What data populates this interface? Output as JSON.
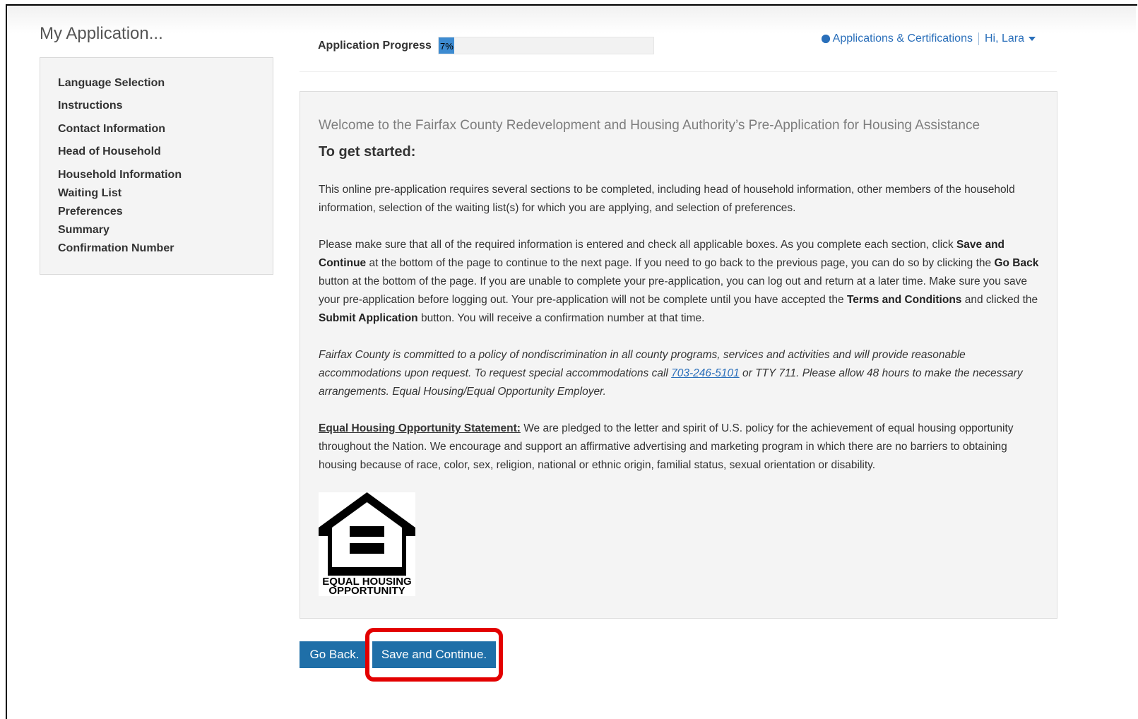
{
  "app_title": "My Application...",
  "sidebar": {
    "items": [
      {
        "label": "Language Selection"
      },
      {
        "label": "Instructions"
      },
      {
        "label": "Contact Information"
      },
      {
        "label": "Head of Household"
      },
      {
        "label": "Household Information"
      },
      {
        "label": "Waiting List"
      },
      {
        "label": "Preferences"
      },
      {
        "label": "Summary"
      },
      {
        "label": "Confirmation Number"
      }
    ]
  },
  "progress": {
    "label": "Application Progress",
    "percent_text": "7%",
    "value": 0.07
  },
  "header": {
    "applications_link": "Applications & Certifications",
    "user_menu": "Hi, Lara",
    "icon": "gear-icon",
    "link_color": "#2a6fba"
  },
  "content": {
    "welcome": "Welcome to the Fairfax County Redevelopment and Housing Authority’s Pre-Application for Housing Assistance",
    "started": "To get started:",
    "p1": "This online pre-application requires several sections to be completed, including head of household information, other members of the household information, selection of the waiting list(s) for which you are applying, and selection of preferences.",
    "p2": {
      "t1": "Please make sure that all of the required information is entered and check all applicable boxes.  As you complete each section, click ",
      "b1": "Save and Continue",
      "t2": " at the bottom of the page to continue to the next page.  If you need to go back to the previous page, you can do so by clicking the ",
      "b2": "Go Back",
      "t3": " button at the bottom of the page.  If you are unable to complete your pre-application, you can log out and return at a later time.  Make sure you save your pre-application before logging out.  Your pre-application will not be complete until you have accepted the ",
      "b3": "Terms and Conditions",
      "t4": " and clicked the ",
      "b4": "Submit Application",
      "t5": " button.  You will receive a confirmation number at that time."
    },
    "p3": {
      "t1": "Fairfax County is committed to a policy of nondiscrimination in all county programs, services and activities and will provide reasonable accommodations upon request. To request special accommodations call ",
      "phone": "703-246-5101",
      "t2": " or TTY 711. Please allow 48 hours to make the necessary arrangements. Equal Housing/Equal Opportunity Employer."
    },
    "p4": {
      "heading": "Equal Housing Opportunity Statement:",
      "text": " We are pledged to the letter and spirit of U.S. policy for the achievement of equal housing opportunity throughout the Nation. We encourage and support an affirmative advertising and marketing program in which there are no barriers to obtaining housing because of race, color, sex, religion, national or ethnic origin, familial status, sexual orientation or disability."
    },
    "logo": {
      "line1": "EQUAL HOUSING",
      "line2": "OPPORTUNITY"
    }
  },
  "buttons": {
    "go_back": "Go Back.",
    "save_continue": "Save and Continue."
  },
  "colors": {
    "button": "#1f6fa8",
    "highlight": "#e30000",
    "progress": "#3d8bd1"
  }
}
